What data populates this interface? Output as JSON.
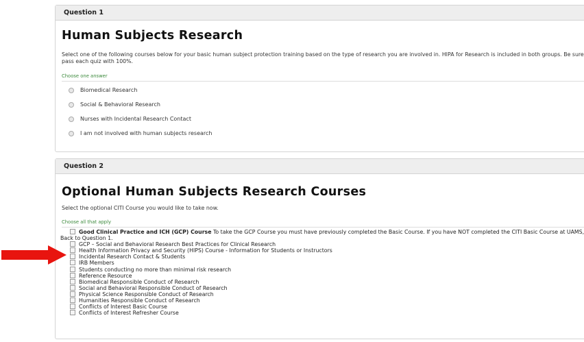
{
  "question1": {
    "header": "Question 1",
    "title": "Human Subjects Research",
    "description": "Select one of the following courses below for your basic human subject protection training based on the type of research you are involved in. HIPA for Research is included in both groups. Be sure to pass each quiz with 100%.",
    "choose_label": "Choose one answer",
    "options": [
      "Biomedical Research",
      "Social & Behavioral Research",
      "Nurses with Incidental Research Contact",
      "I am not involved with human subjects research"
    ]
  },
  "question2": {
    "header": "Question 2",
    "title": "Optional Human Subjects Research Courses",
    "description": "Select the optional CITI Course you would like to take now.",
    "choose_label": "Choose all that apply",
    "first_option_bold": "Good Clinical Practice and ICH (GCP) Course",
    "first_option_text": " To take the GCP Course you must have previously completed the Basic Course. If you have NOT completed the CITI Basic Course at UAMS, Go Back to Question 1.",
    "options": [
      "GCP – Social and Behavioral Research Best Practices for Clinical Research",
      "Health Information Privacy and Security (HIPS) Course - Information for Students or Instructors",
      "Incidental Research Contact & Students",
      "IRB Members",
      "Students conducting no more than minimal risk research",
      "Reference Resource",
      "Biomedical Responsible Conduct of Research",
      "Social and Behavioral Responsible Conduct of Research",
      "Physical Science Responsible Conduct of Research",
      "Humanities Responsible Conduct of Research",
      "Conflicts of Interest Basic Course",
      "Conflicts of Interest Refresher Course"
    ]
  },
  "colors": {
    "choose_label": "#3c8a3c",
    "annotation_arrow": "#e8140f",
    "header_bg": "#eeeeee"
  },
  "annotation": {
    "icon": "red-arrow-icon"
  }
}
